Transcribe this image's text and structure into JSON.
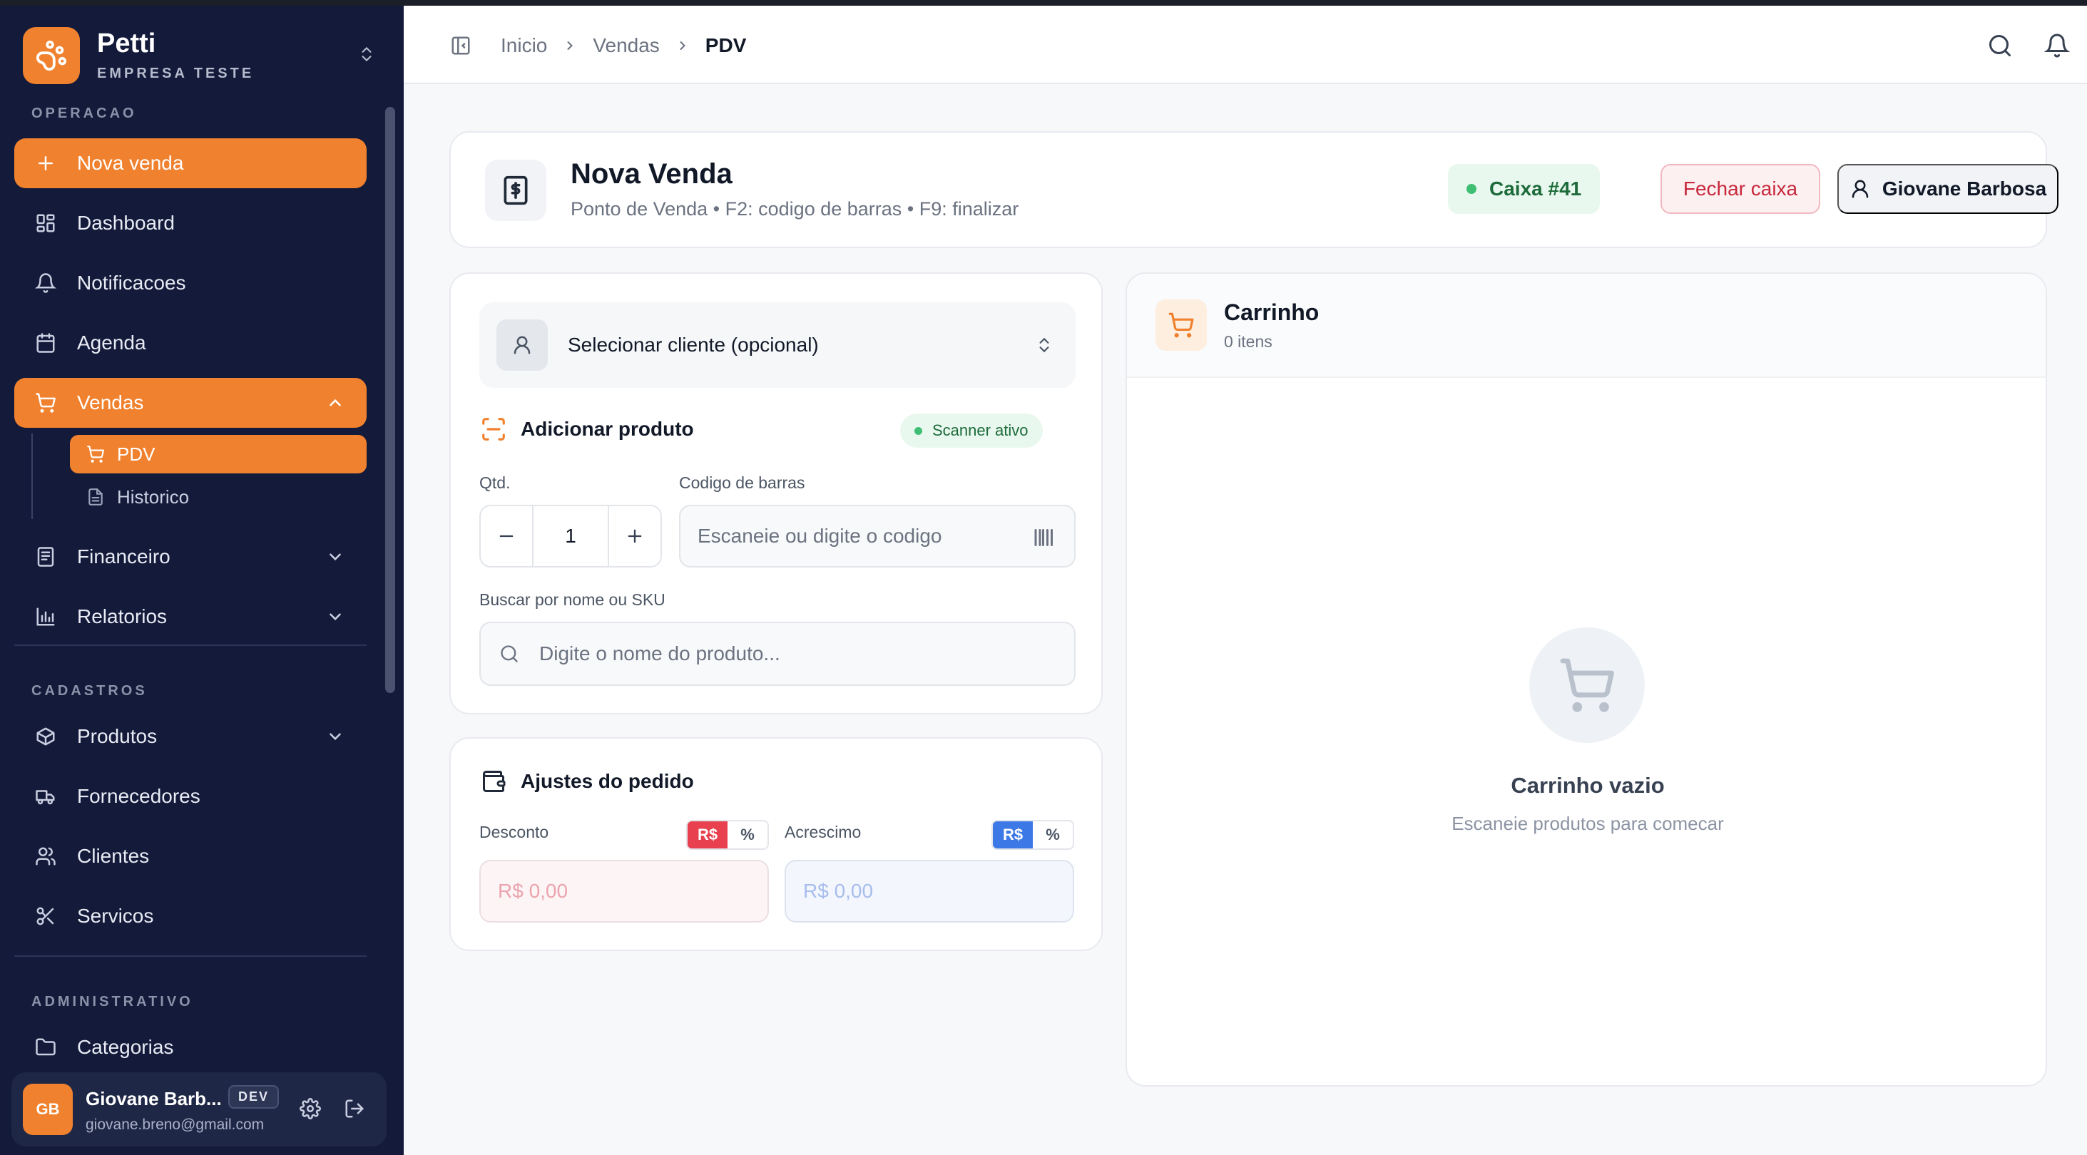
{
  "colors": {
    "accent": "#f0812e",
    "sidebar_bg": "#131a3a",
    "success": "#3fbf73",
    "danger": "#e8404f",
    "primary_blue": "#3d79e6"
  },
  "brand": {
    "name": "Petti",
    "subtitle": "EMPRESA TESTE",
    "logo_icon": "paw-icon",
    "switch_icon": "chevrons-up-down-icon"
  },
  "sidebar": {
    "sections": {
      "operacao": "OPERACAO",
      "cadastros": "CADASTROS",
      "administrativo": "ADMINISTRATIVO"
    },
    "items": {
      "nova_venda": {
        "label": "Nova venda",
        "icon": "plus-icon"
      },
      "dashboard": {
        "label": "Dashboard",
        "icon": "grid-icon"
      },
      "notificacoes": {
        "label": "Notificacoes",
        "icon": "bell-icon"
      },
      "agenda": {
        "label": "Agenda",
        "icon": "calendar-icon"
      },
      "vendas": {
        "label": "Vendas",
        "icon": "cart-icon"
      },
      "pdv": {
        "label": "PDV",
        "icon": "cart-icon"
      },
      "historico": {
        "label": "Historico",
        "icon": "document-icon"
      },
      "financeiro": {
        "label": "Financeiro",
        "icon": "receipt-icon"
      },
      "relatorios": {
        "label": "Relatorios",
        "icon": "bar-chart-icon"
      },
      "produtos": {
        "label": "Produtos",
        "icon": "box-icon"
      },
      "fornecedores": {
        "label": "Fornecedores",
        "icon": "truck-icon"
      },
      "clientes": {
        "label": "Clientes",
        "icon": "users-icon"
      },
      "servicos": {
        "label": "Servicos",
        "icon": "scissors-icon"
      },
      "categorias": {
        "label": "Categorias",
        "icon": "folder-icon"
      }
    }
  },
  "user": {
    "initials": "GB",
    "name": "Giovane Barb...",
    "email": "giovane.breno@gmail.com",
    "badge": "DEV"
  },
  "header": {
    "breadcrumb": [
      "Inicio",
      "Vendas",
      "PDV"
    ]
  },
  "page": {
    "title": "Nova Venda",
    "subtitle": "Ponto de Venda • F2: codigo de barras • F9: finalizar",
    "caixa": "Caixa #41",
    "close_register": "Fechar caixa",
    "operator": "Giovane Barbosa"
  },
  "product_panel": {
    "client_select": "Selecionar cliente (opcional)",
    "add_product": "Adicionar produto",
    "scanner_status": "Scanner ativo",
    "qty_label": "Qtd.",
    "qty_value": "1",
    "barcode_label": "Codigo de barras",
    "barcode_placeholder": "Escaneie ou digite o codigo",
    "search_label": "Buscar por nome ou SKU",
    "search_placeholder": "Digite o nome do produto..."
  },
  "adjustments": {
    "title": "Ajustes do pedido",
    "discount_label": "Desconto",
    "surcharge_label": "Acrescimo",
    "mode_currency": "R$",
    "mode_percent": "%",
    "discount_placeholder": "R$ 0,00",
    "surcharge_placeholder": "R$ 0,00"
  },
  "cart": {
    "title": "Carrinho",
    "count": "0 itens",
    "empty_title": "Carrinho vazio",
    "empty_sub": "Escaneie produtos para comecar"
  }
}
